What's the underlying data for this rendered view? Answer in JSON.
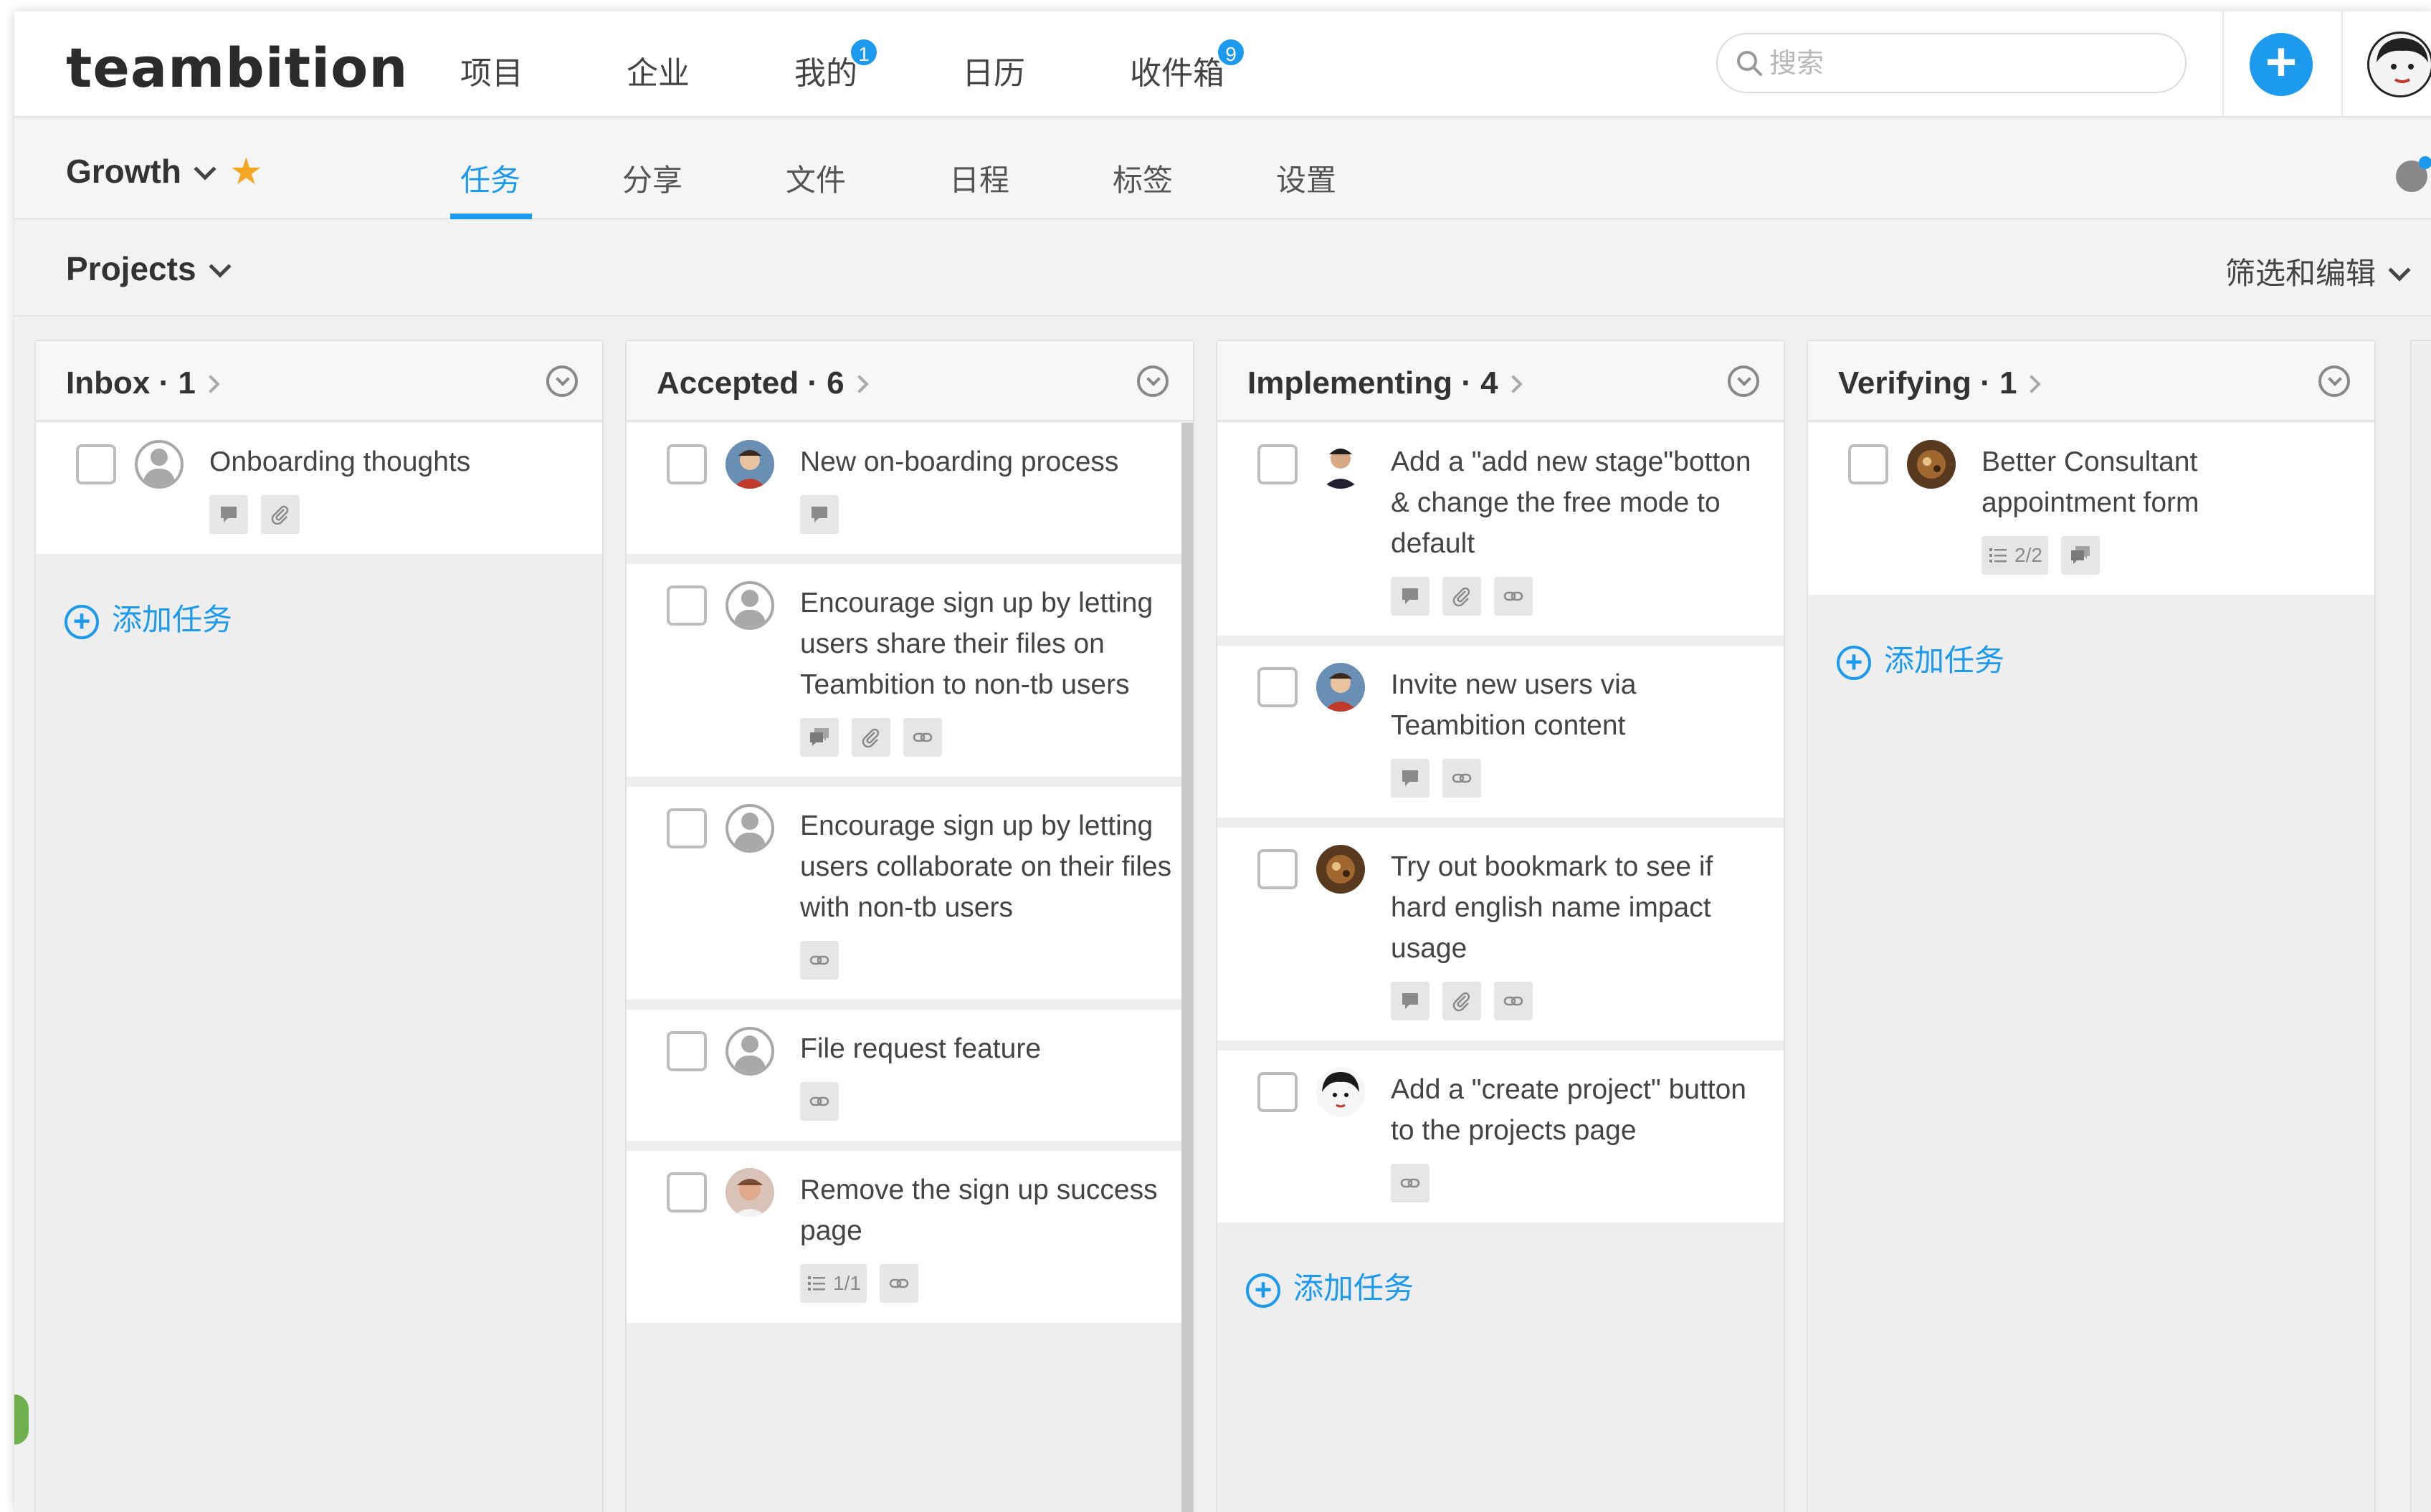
{
  "app": {
    "logo": "teambition",
    "nav": [
      {
        "label": "项目",
        "badge": null
      },
      {
        "label": "企业",
        "badge": null
      },
      {
        "label": "我的",
        "badge": "1"
      },
      {
        "label": "日历",
        "badge": null
      },
      {
        "label": "收件箱",
        "badge": "9"
      }
    ],
    "search_placeholder": "搜索",
    "add_button": "+"
  },
  "project": {
    "name": "Growth",
    "tabs": [
      "任务",
      "分享",
      "文件",
      "日程",
      "标签",
      "设置"
    ],
    "active_tab": "任务"
  },
  "view": {
    "name": "Projects",
    "filter_label": "筛选和编辑"
  },
  "colors": {
    "accent": "#1b9aee",
    "star": "#f5a623"
  },
  "columns": [
    {
      "title": "Inbox · 1",
      "cards": [
        {
          "text": "Onboarding thoughts",
          "avatar": "default",
          "meta": [
            {
              "icon": "comment-icon"
            },
            {
              "icon": "attachment-icon"
            }
          ]
        }
      ],
      "add_task": "添加任务"
    },
    {
      "title": "Accepted · 6",
      "cards": [
        {
          "text": "New on-boarding process",
          "avatar": "photo-blue",
          "meta": [
            {
              "icon": "comment-icon"
            }
          ]
        },
        {
          "text": "Encourage sign up by letting users share their files on Teambition to non-tb users",
          "avatar": "default",
          "meta": [
            {
              "icon": "comments-icon"
            },
            {
              "icon": "attachment-icon"
            },
            {
              "icon": "link-icon"
            }
          ]
        },
        {
          "text": "Encourage sign up by letting users collaborate on their files with non-tb users",
          "avatar": "default",
          "meta": [
            {
              "icon": "link-icon"
            }
          ]
        },
        {
          "text": "File request feature",
          "avatar": "default",
          "meta": [
            {
              "icon": "link-icon"
            }
          ]
        },
        {
          "text": "Remove the sign up success page",
          "avatar": "photo-pink",
          "meta": [
            {
              "icon": "checklist-icon",
              "label": "1/1"
            },
            {
              "icon": "link-icon"
            }
          ]
        }
      ],
      "add_task": ""
    },
    {
      "title": "Implementing · 4",
      "cards": [
        {
          "text": "Add a \"add new stage\"botton & change the free mode to default",
          "avatar": "photo-dark",
          "meta": [
            {
              "icon": "comment-icon"
            },
            {
              "icon": "attachment-icon"
            },
            {
              "icon": "link-icon"
            }
          ]
        },
        {
          "text": "Invite new users via Teambition content",
          "avatar": "photo-blue",
          "meta": [
            {
              "icon": "comment-icon"
            },
            {
              "icon": "link-icon"
            }
          ]
        },
        {
          "text": "Try out bookmark to see if hard english name impact usage",
          "avatar": "photo-brown",
          "meta": [
            {
              "icon": "comment-icon"
            },
            {
              "icon": "attachment-icon"
            },
            {
              "icon": "link-icon"
            }
          ]
        },
        {
          "text": "Add a \"create project\" button to the projects page",
          "avatar": "photo-bw",
          "meta": [
            {
              "icon": "link-icon"
            }
          ]
        }
      ],
      "add_task": "添加任务"
    },
    {
      "title": "Verifying · 1",
      "cards": [
        {
          "text": "Better Consultant appointment form",
          "avatar": "photo-brown",
          "meta": [
            {
              "icon": "checklist-icon",
              "label": "2/2"
            },
            {
              "icon": "comments-icon"
            }
          ]
        }
      ],
      "add_task": "添加任务"
    }
  ]
}
